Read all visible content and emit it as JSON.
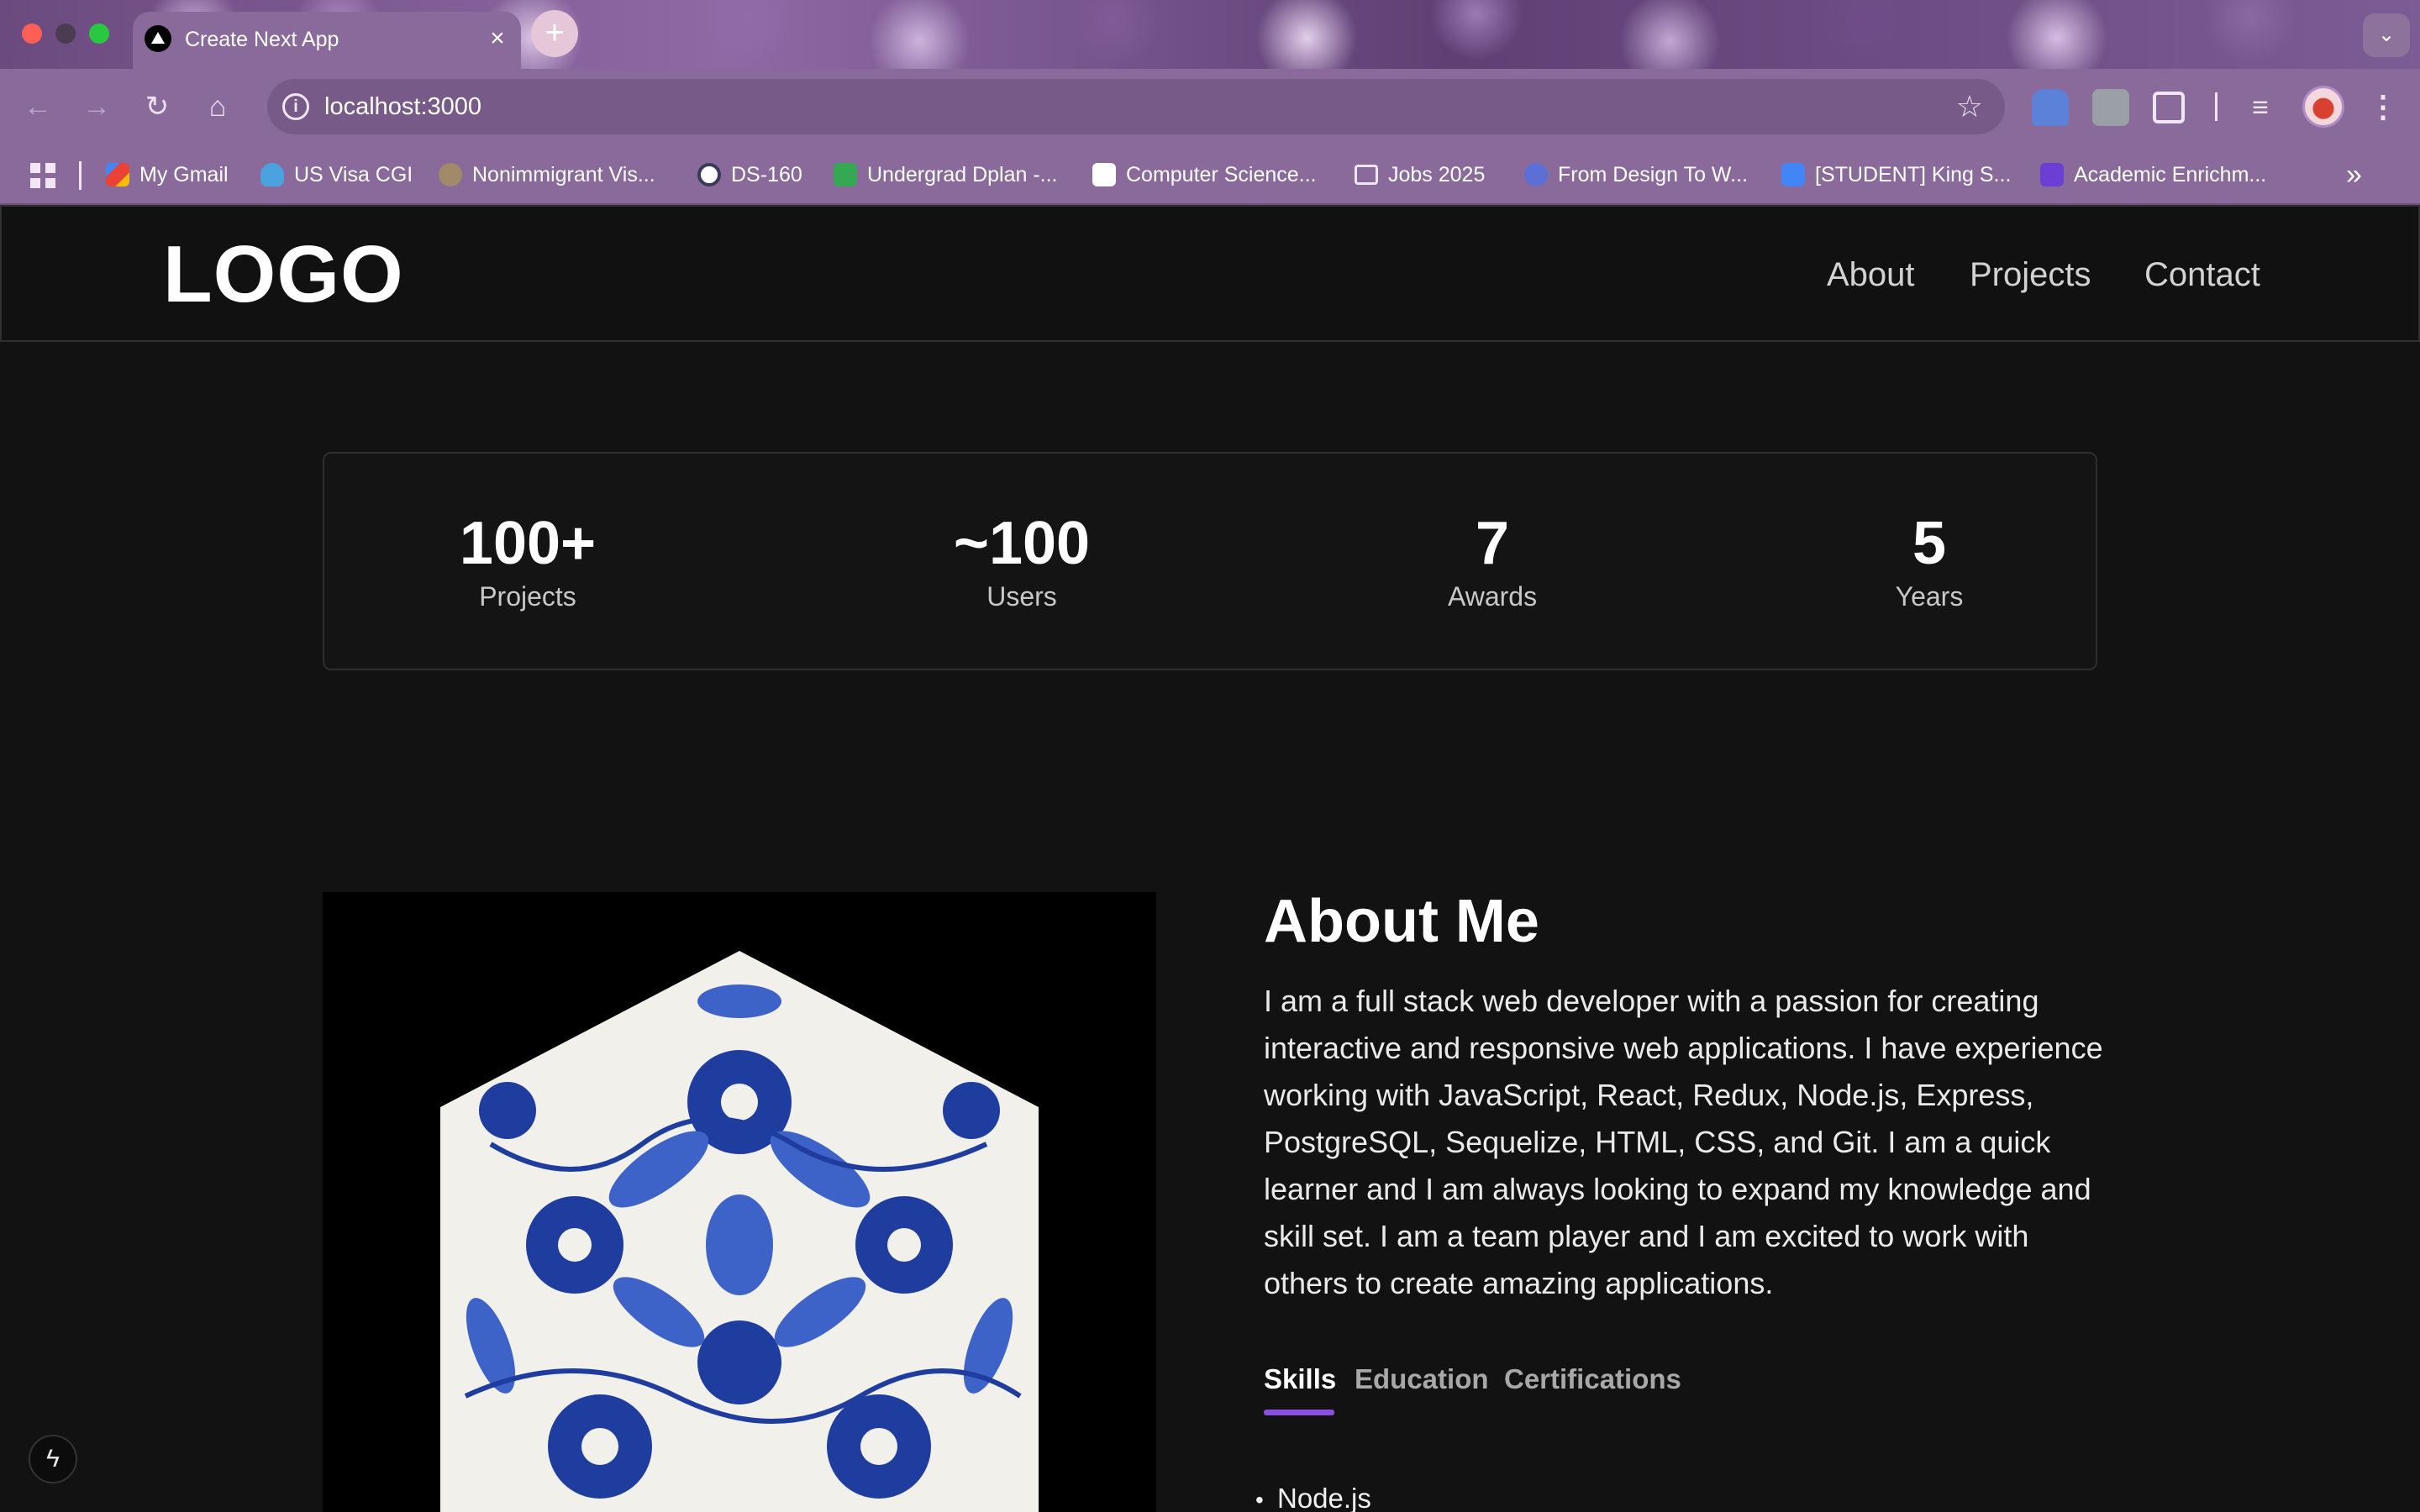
{
  "browser": {
    "tab": {
      "title": "Create Next App",
      "close_icon": "close-icon"
    },
    "new_tab_icon": "plus-icon",
    "url": "localhost:3000",
    "bookmarks": [
      {
        "label": "My Gmail",
        "icon_color": "#ea4335"
      },
      {
        "label": "US Visa CGI",
        "icon_color": "#4aa3df"
      },
      {
        "label": "Nonimmigrant Vis...",
        "icon_color": "#a08a6a"
      },
      {
        "label": "DS-160",
        "icon_color": "#ffffff"
      },
      {
        "label": "Undergrad Dplan -...",
        "icon_color": "#34a853"
      },
      {
        "label": "Computer Science...",
        "icon_color": "#ffffff"
      },
      {
        "label": "Jobs 2025",
        "icon_color": "folder"
      },
      {
        "label": "From Design To W...",
        "icon_color": "#5b6fd6"
      },
      {
        "label": "[STUDENT] King S...",
        "icon_color": "#4285f4"
      },
      {
        "label": "Academic Enrichm...",
        "icon_color": "#6b3fd4"
      }
    ]
  },
  "site": {
    "logo": "LOGO",
    "nav": [
      "About",
      "Projects",
      "Contact"
    ],
    "stats": [
      {
        "value": "100+",
        "label": "Projects"
      },
      {
        "value": "~100",
        "label": "Users"
      },
      {
        "value": "7",
        "label": "Awards"
      },
      {
        "value": "5",
        "label": "Years"
      }
    ],
    "about": {
      "title": "About Me",
      "text": "I am a full stack web developer with a passion for creating interactive and responsive web applications. I have experience working with JavaScript, React, Redux, Node.js, Express, PostgreSQL, Sequelize, HTML, CSS, and Git. I am a quick learner and I am always looking to expand my knowledge and skill set. I am a team player and I am excited to work with others to create amazing applications.",
      "tabs": [
        "Skills",
        "Education",
        "Certifications"
      ],
      "active_tab": "Skills",
      "skills": [
        "Node.js"
      ]
    }
  },
  "colors": {
    "accent": "#8a4fe0",
    "page_bg": "#121212"
  }
}
